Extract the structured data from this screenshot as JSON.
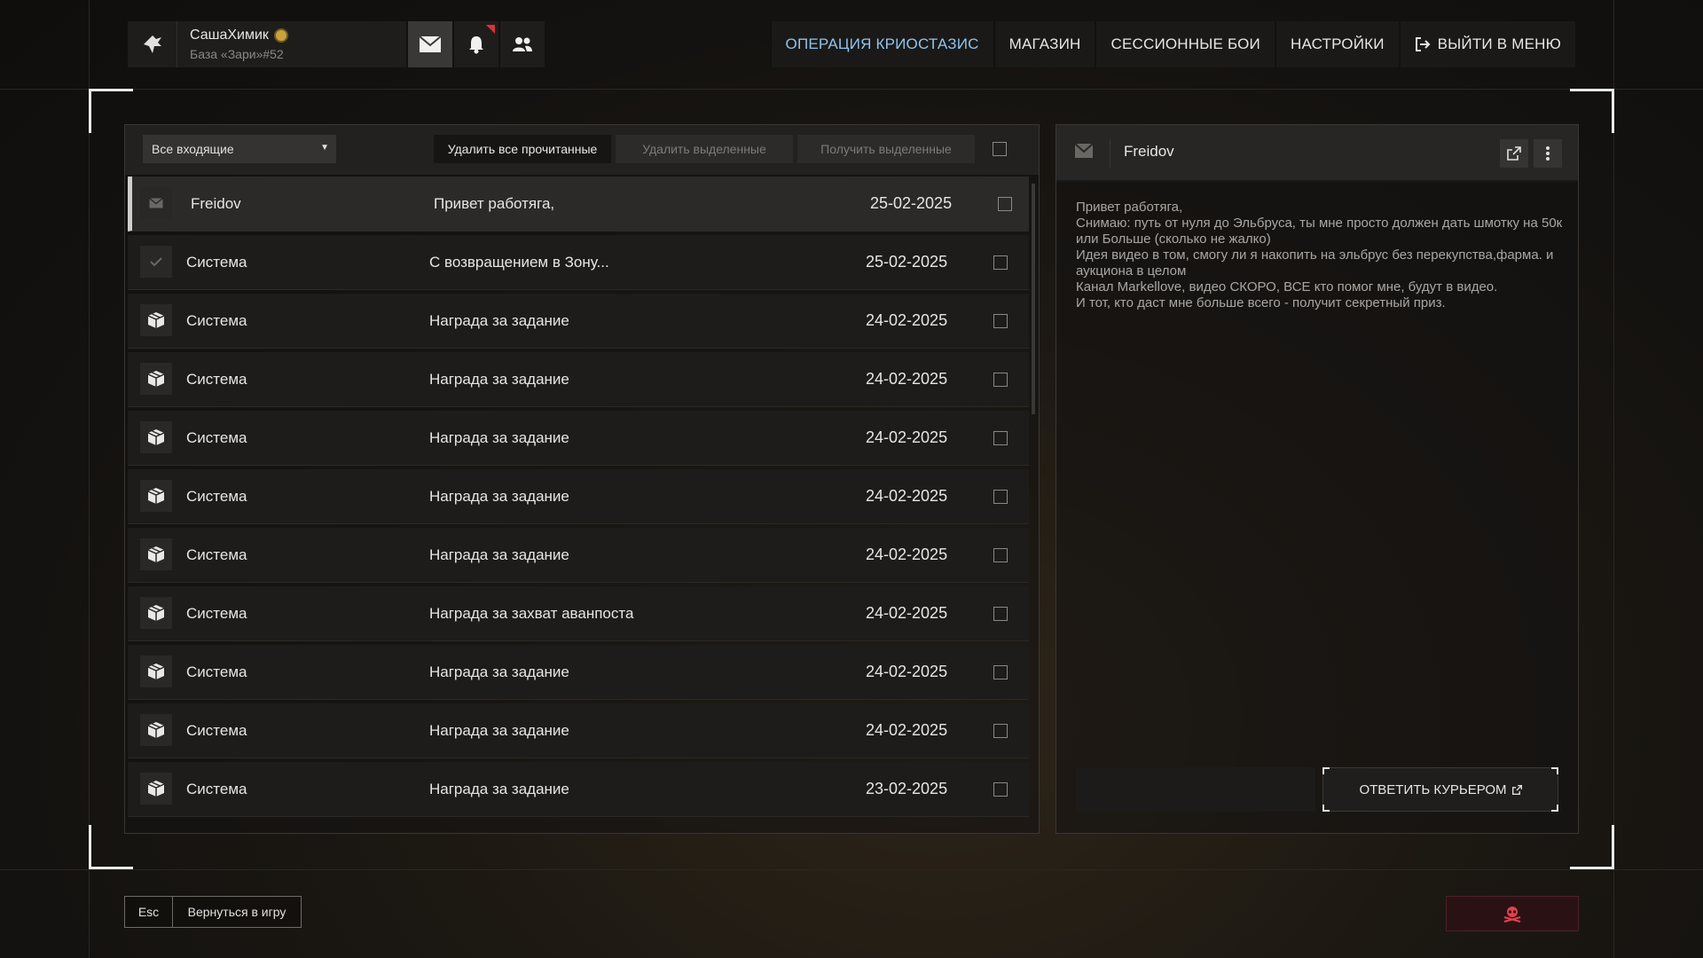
{
  "profile": {
    "name": "СашаХимик",
    "base": "База «Зари»#52",
    "logo_icon": "eagle-logo-icon",
    "badge_icon": "sun-badge-icon"
  },
  "top_icons": {
    "mail": "envelope-icon",
    "notifications": "bell-icon",
    "friends": "users-icon"
  },
  "nav": [
    {
      "label": "ОПЕРАЦИЯ КРИОСТАЗИС",
      "accent": true
    },
    {
      "label": "МАГАЗИН",
      "accent": false
    },
    {
      "label": "СЕССИОННЫЕ БОИ",
      "accent": false
    },
    {
      "label": "НАСТРОЙКИ",
      "accent": false
    },
    {
      "label": "ВЫЙТИ В МЕНЮ",
      "accent": false,
      "icon": "exit-icon"
    }
  ],
  "toolbar": {
    "filter_value": "Все входящие",
    "delete_read": "Удалить все прочитанные",
    "delete_selected": "Удалить выделенные",
    "get_selected": "Получить выделенные"
  },
  "messages": [
    {
      "icon": "envelope-icon",
      "sender": "Freidov",
      "subject": "Привет работяга,",
      "date": "25-02-2025",
      "selected": true
    },
    {
      "icon": "check-icon",
      "sender": "Система",
      "subject": "С возвращением в Зону...",
      "date": "25-02-2025",
      "selected": false
    },
    {
      "icon": "package-icon",
      "sender": "Система",
      "subject": "Награда за задание",
      "date": "24-02-2025",
      "selected": false
    },
    {
      "icon": "package-icon",
      "sender": "Система",
      "subject": "Награда за задание",
      "date": "24-02-2025",
      "selected": false
    },
    {
      "icon": "package-icon",
      "sender": "Система",
      "subject": "Награда за задание",
      "date": "24-02-2025",
      "selected": false
    },
    {
      "icon": "package-icon",
      "sender": "Система",
      "subject": "Награда за задание",
      "date": "24-02-2025",
      "selected": false
    },
    {
      "icon": "package-icon",
      "sender": "Система",
      "subject": "Награда за задание",
      "date": "24-02-2025",
      "selected": false
    },
    {
      "icon": "package-icon",
      "sender": "Система",
      "subject": "Награда за захват аванпоста",
      "date": "24-02-2025",
      "selected": false
    },
    {
      "icon": "package-icon",
      "sender": "Система",
      "subject": "Награда за задание",
      "date": "24-02-2025",
      "selected": false
    },
    {
      "icon": "package-icon",
      "sender": "Система",
      "subject": "Награда за задание",
      "date": "24-02-2025",
      "selected": false
    },
    {
      "icon": "package-icon",
      "sender": "Система",
      "subject": "Награда за задание",
      "date": "23-02-2025",
      "selected": false
    }
  ],
  "reader": {
    "from": "Freidov",
    "body": "Привет работяга,\nСнимаю: путь от нуля до Эльбруса, ты мне просто должен дать шмотку на 50к или Больше (сколько не жалко)\nИдея видео в том, смогу ли я накопить на эльбрус без перекупства,фарма. и аукциона в целом\nКанал Markellove, видео СКОРО, ВСЕ кто помог мне, будут в видео.\nИ тот, кто даст мне больше всего - получит секретный приз.",
    "reply_label": "ОТВЕТИТЬ КУРЬЕРОМ"
  },
  "bottom": {
    "esc_key": "Esc",
    "esc_label": "Вернуться в игру",
    "danger_icon": "skull-icon"
  },
  "colors": {
    "accent": "#8fc4ee",
    "notification": "#d9323e",
    "danger": "#e0424e"
  }
}
